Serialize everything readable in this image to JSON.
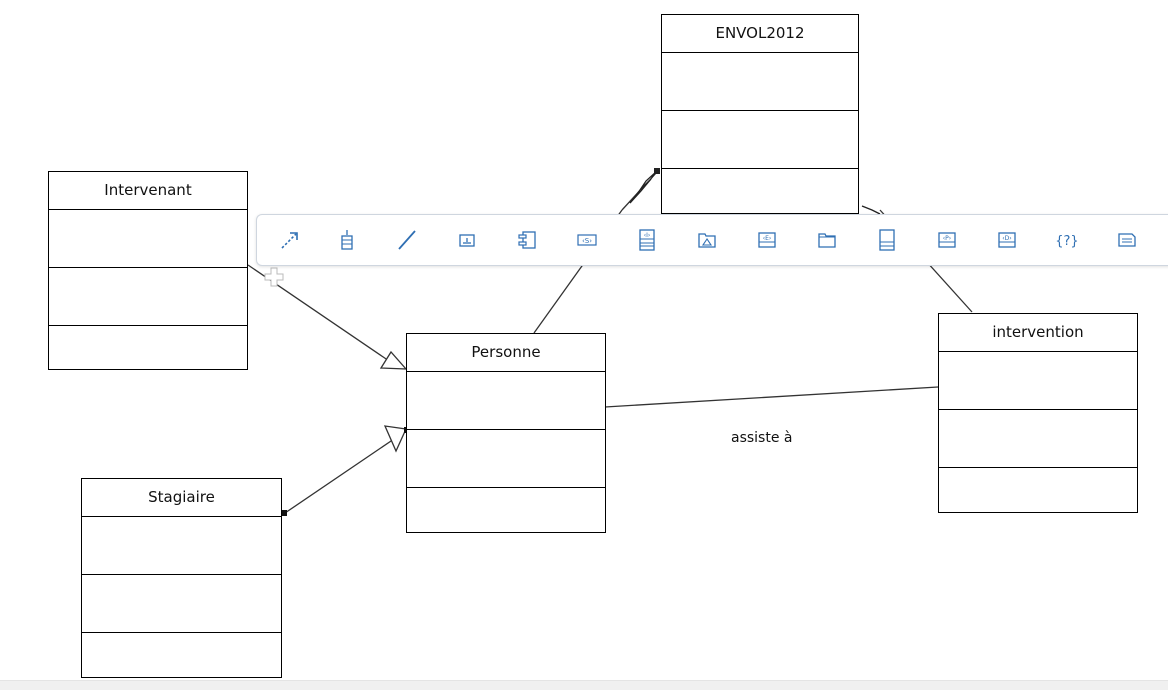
{
  "diagram": {
    "classes": [
      {
        "id": "envol",
        "name": "ENVOL2012"
      },
      {
        "id": "intervenant",
        "name": "Intervenant"
      },
      {
        "id": "personne",
        "name": "Personne"
      },
      {
        "id": "intervention",
        "name": "intervention"
      },
      {
        "id": "stagiaire",
        "name": "Stagiaire"
      }
    ],
    "relationships": [
      {
        "type": "generalization",
        "from": "Intervenant",
        "to": "Personne"
      },
      {
        "type": "generalization",
        "from": "Stagiaire",
        "to": "Personne"
      },
      {
        "type": "association",
        "from": "Personne",
        "to": "intervention",
        "label": "assiste à"
      },
      {
        "type": "aggregation",
        "from": "Personne",
        "to": "ENVOL2012"
      },
      {
        "type": "aggregation",
        "from": "intervention",
        "to": "ENVOL2012"
      }
    ]
  },
  "palette": {
    "tools": [
      {
        "icon": "dependency-icon"
      },
      {
        "icon": "lifeline-icon"
      },
      {
        "icon": "association-line-icon"
      },
      {
        "icon": "note-icon"
      },
      {
        "icon": "component-icon"
      },
      {
        "icon": "stereotype-s-icon"
      },
      {
        "icon": "interface-icon"
      },
      {
        "icon": "abstract-class-icon"
      },
      {
        "icon": "enumeration-icon"
      },
      {
        "icon": "package-icon"
      },
      {
        "icon": "class-icon"
      },
      {
        "icon": "primitive-type-icon"
      },
      {
        "icon": "datatype-icon"
      },
      {
        "icon": "constraint-icon"
      },
      {
        "icon": "comment-icon"
      }
    ]
  },
  "colors": {
    "line": "#000000",
    "palette_icon": "#2f6fb3",
    "palette_border": "#cfd6df"
  }
}
